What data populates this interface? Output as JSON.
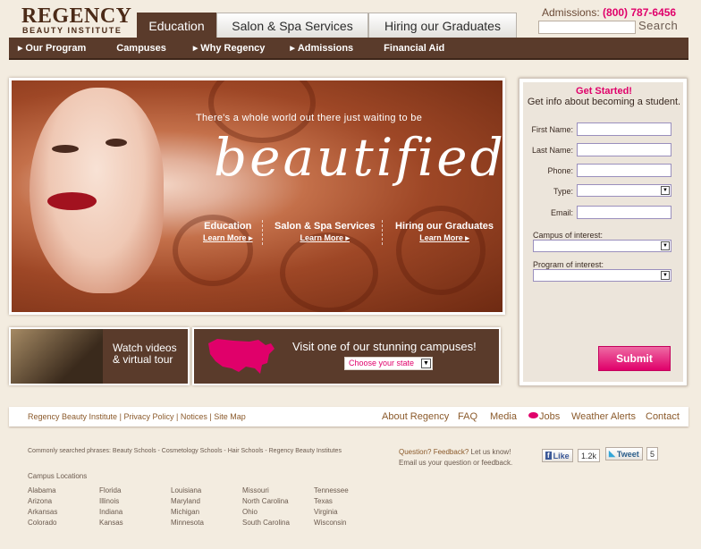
{
  "header": {
    "logo_main": "REGENCY",
    "logo_sub": "BEAUTY INSTITUTE",
    "tabs": [
      {
        "label": "Education"
      },
      {
        "label": "Salon & Spa Services"
      },
      {
        "label": "Hiring our Graduates"
      }
    ],
    "admissions_label": "Admissions:",
    "admissions_phone": "(800) 787-6456",
    "search_label": "Search"
  },
  "nav": {
    "items": [
      {
        "label": "Our Program",
        "arrow": "▶"
      },
      {
        "label": "Campuses",
        "arrow": ""
      },
      {
        "label": "Why Regency",
        "arrow": "▶"
      },
      {
        "label": "Admissions",
        "arrow": "▶"
      },
      {
        "label": "Financial Aid",
        "arrow": ""
      }
    ]
  },
  "hero": {
    "tagline": "There's a whole world out there just waiting to be",
    "headline": "beautified.",
    "links": [
      {
        "title": "Education",
        "more": "Learn More ▸"
      },
      {
        "title": "Salon & Spa Services",
        "more": "Learn More ▸"
      },
      {
        "title": "Hiring our Graduates",
        "more": "Learn More ▸"
      }
    ]
  },
  "promos": {
    "videos_line1": "Watch videos",
    "videos_line2": "& virtual tour",
    "campuses_text": "Visit one of our stunning campuses!",
    "state_select": "Choose your state"
  },
  "form": {
    "title": "Get Started!",
    "subtitle": "Get info about becoming a student.",
    "first_name": "First Name:",
    "last_name": "Last Name:",
    "phone": "Phone:",
    "type": "Type:",
    "email": "Email:",
    "campus": "Campus of interest:",
    "program": "Program of interest:",
    "submit": "Submit"
  },
  "footer": {
    "left_links": [
      "Regency Beauty Institute",
      "Privacy Policy",
      "Notices",
      "Site Map"
    ],
    "separator": "|",
    "right_links": [
      "About Regency",
      "FAQ",
      "Media",
      "Jobs",
      "Weather Alerts",
      "Contact"
    ],
    "phrases": "Commonly searched phrases: Beauty Schools - Cosmetology Schools - Hair Schools - Regency Beauty Institutes",
    "question": "Question? Feedback?",
    "let_us_know": "Let us know!",
    "email_us": "Email us your question or feedback.",
    "like_label": "Like",
    "like_count": "1.2k",
    "tweet_label": "Tweet",
    "tweet_count": "5",
    "campus_heading": "Campus Locations",
    "campus_columns": [
      [
        "Alabama",
        "Arizona",
        "Arkansas",
        "Colorado"
      ],
      [
        "Florida",
        "Illinois",
        "Indiana",
        "Kansas"
      ],
      [
        "Louisiana",
        "Maryland",
        "Michigan",
        "Minnesota"
      ],
      [
        "Missouri",
        "North Carolina",
        "Ohio",
        "South Carolina"
      ],
      [
        "Tennessee",
        "Texas",
        "Virginia",
        "Wisconsin"
      ]
    ]
  }
}
